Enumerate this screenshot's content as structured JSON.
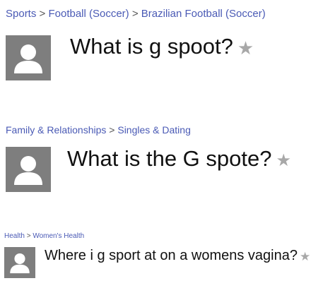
{
  "results": [
    {
      "breadcrumb": [
        {
          "label": "Sports"
        },
        {
          "label": "Football (Soccer)"
        },
        {
          "label": "Brazilian Football (Soccer)"
        }
      ],
      "separator": ">",
      "question": "What is g spoot?",
      "avatar_icon": "default-user-avatar-icon",
      "star_icon": "star-icon"
    },
    {
      "breadcrumb": [
        {
          "label": "Family & Relationships"
        },
        {
          "label": "Singles & Dating"
        }
      ],
      "separator": ">",
      "question": "What is the G spote?",
      "avatar_icon": "default-user-avatar-icon",
      "star_icon": "star-icon"
    },
    {
      "breadcrumb": [
        {
          "label": "Health"
        },
        {
          "label": "Women's Health"
        }
      ],
      "separator": ">",
      "question": "Where i g sport at on a womens vagina?",
      "avatar_icon": "default-user-avatar-icon",
      "star_icon": "star-icon"
    }
  ],
  "colors": {
    "link": "#4a5ab5",
    "avatar_bg": "#7e7e7e",
    "star": "#a8a8a8"
  }
}
